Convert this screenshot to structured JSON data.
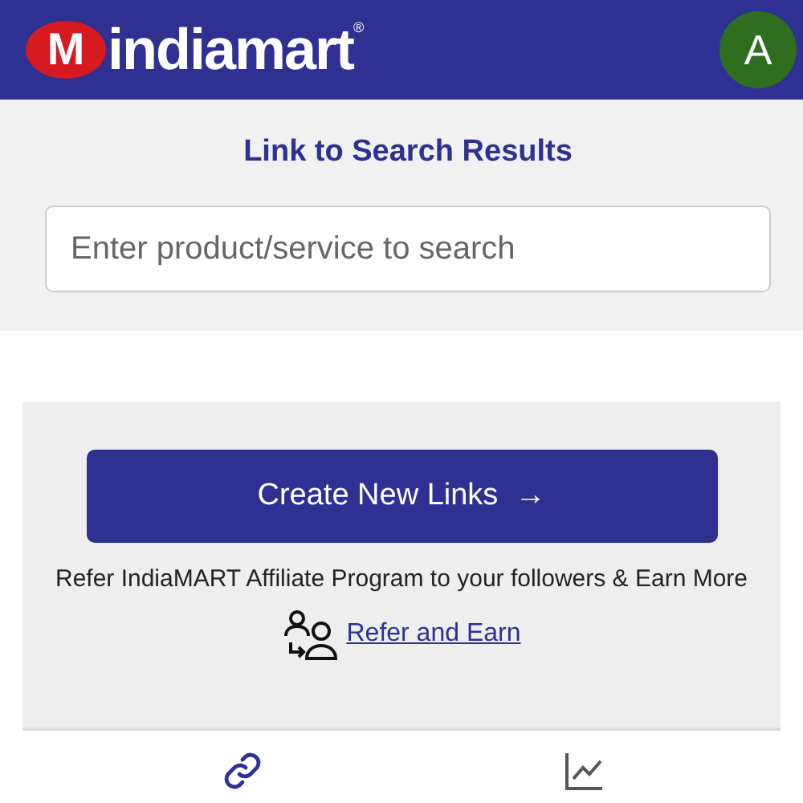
{
  "header": {
    "logo": {
      "mark": "M",
      "name": "indiamart",
      "registered": "®"
    },
    "avatar": "A"
  },
  "search": {
    "title": "Link to Search Results",
    "placeholder": "Enter product/service to search"
  },
  "promo": {
    "button": "Create New Links",
    "button_arrow": "→",
    "text": "Refer IndiaMART Affiliate Program to your followers & Earn More",
    "link": "Refer and Earn"
  },
  "bottom_tabs": [
    {
      "kind": "link"
    },
    {
      "kind": "chart"
    }
  ]
}
